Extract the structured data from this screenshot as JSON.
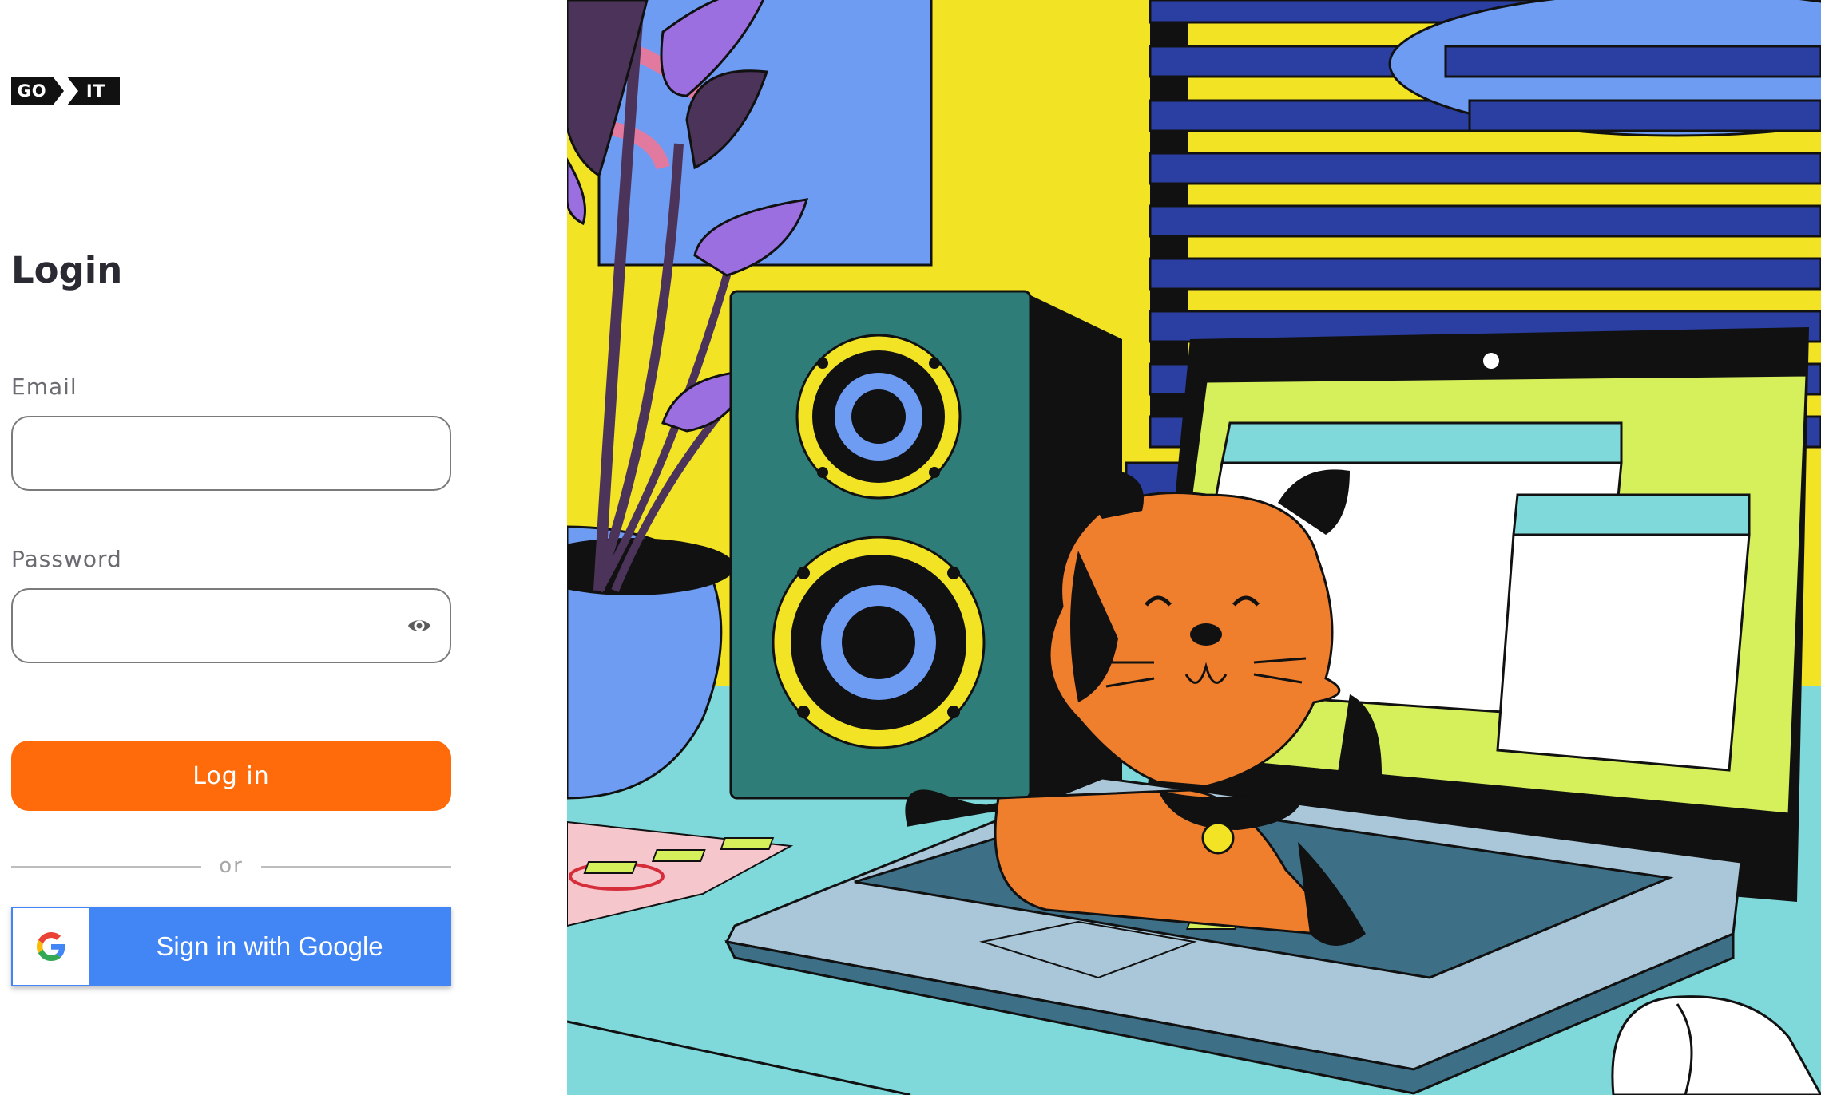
{
  "logo": {
    "part1": "GO",
    "part2": "IT"
  },
  "login": {
    "title": "Login",
    "email_label": "Email",
    "email_value": "",
    "password_label": "Password",
    "password_value": "",
    "submit_label": "Log in",
    "divider_text": "or",
    "google_label": "Sign in with Google"
  },
  "colors": {
    "accent": "#ff6b0a",
    "google_blue": "#4285f4",
    "title_text": "#2a2a33",
    "label_text": "#6b6b72"
  },
  "icons": {
    "password_toggle": "eye-icon",
    "google": "google-g-icon"
  },
  "illustration": {
    "subject": "illustration-cat-on-laptop"
  }
}
